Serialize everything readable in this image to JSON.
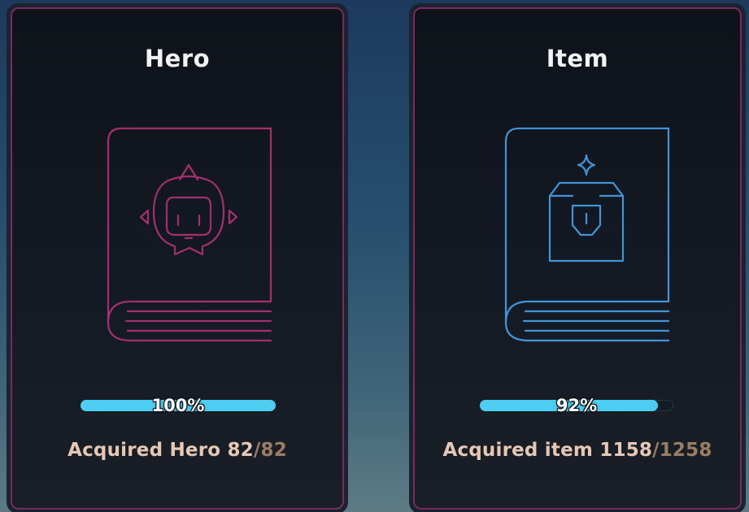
{
  "colors": {
    "hero_accent": "#a3306e",
    "item_accent": "#3f95d8",
    "progress_fill": "#4ccdf2",
    "acquired_text": "#e6c8b4",
    "acquired_total": "#9b7d64"
  },
  "cards": [
    {
      "title": "Hero",
      "icon": "hero-book-icon",
      "progress": 1.0,
      "progress_label": "100%",
      "acquired_label": "Acquired Hero",
      "acquired_count": "82",
      "separator": "/",
      "total_count": "82"
    },
    {
      "title": "Item",
      "icon": "item-book-icon",
      "progress": 0.92,
      "progress_label": "92%",
      "acquired_label": "Acquired item",
      "acquired_count": "1158",
      "separator": "/",
      "total_count": "1258"
    }
  ]
}
